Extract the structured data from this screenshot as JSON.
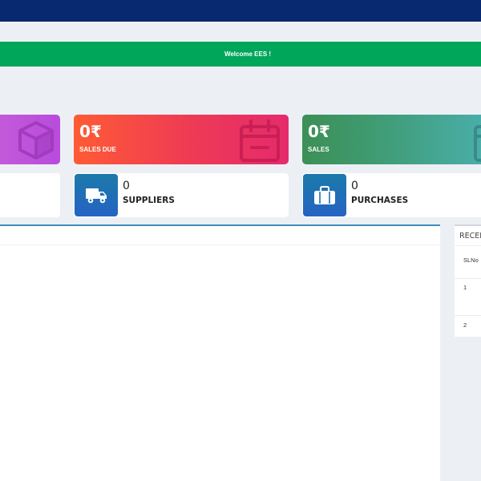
{
  "welcome": {
    "text": "Welcome EES !"
  },
  "cards": [
    {
      "id": "purple",
      "icon": "cube-icon",
      "color": "#b94bdc"
    },
    {
      "id": "sales-due",
      "amount": "0₹",
      "label": "SALES DUE",
      "icon": "calendar-icon",
      "color": "#ee3a55"
    },
    {
      "id": "sales",
      "amount": "0₹",
      "label": "SALES",
      "icon": "calendar-icon",
      "color": "#3f9c74"
    }
  ],
  "info": {
    "suppliers": {
      "count": "0",
      "label": "SUPPLIERS",
      "icon": "truck-icon"
    },
    "purchases": {
      "count": "0",
      "label": "PURCHASES",
      "icon": "briefcase-icon"
    }
  },
  "recent": {
    "title": "RECENTLY ADDED ITEMS",
    "columns": [
      "SLNo"
    ],
    "rows": [
      "1",
      "2"
    ]
  }
}
